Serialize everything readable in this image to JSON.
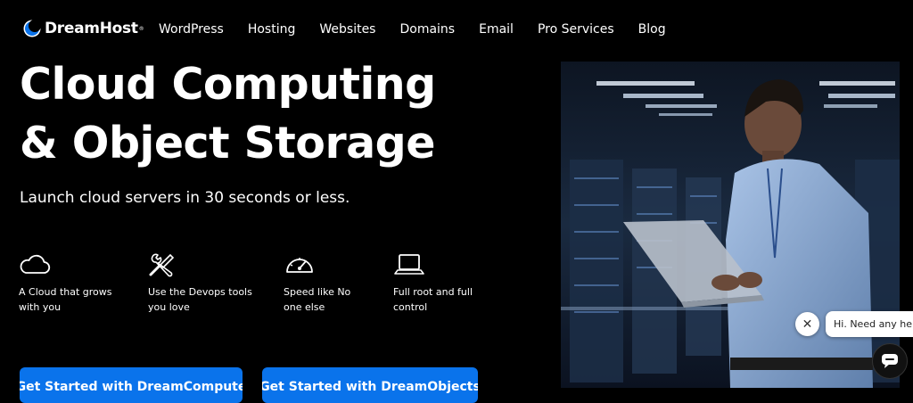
{
  "brand": {
    "name": "DreamHost",
    "tm": "®",
    "accent": "#0a73eb"
  },
  "nav": {
    "items": [
      "WordPress",
      "Hosting",
      "Websites",
      "Domains",
      "Email",
      "Pro Services",
      "Blog"
    ]
  },
  "hero": {
    "title_line1": "Cloud Computing",
    "title_line2": "& Object Storage",
    "subtitle": "Launch cloud servers in 30 seconds or less."
  },
  "features": [
    {
      "icon": "cloud-icon",
      "text": "A Cloud that grows\nwith you"
    },
    {
      "icon": "wrench-screwdriver-icon",
      "text": "Use the Devops tools\nyou love"
    },
    {
      "icon": "speedometer-icon",
      "text": "Speed like No\none else"
    },
    {
      "icon": "laptop-icon",
      "text": "Full root and full\ncontrol"
    }
  ],
  "cta": {
    "compute_label": "Get Started with DreamCompute",
    "objects_label": "Get Started with DreamObjects"
  },
  "chat": {
    "bubble_text": "Hi. Need any help?",
    "close_icon": "close-icon",
    "button_icon": "chat-icon"
  }
}
